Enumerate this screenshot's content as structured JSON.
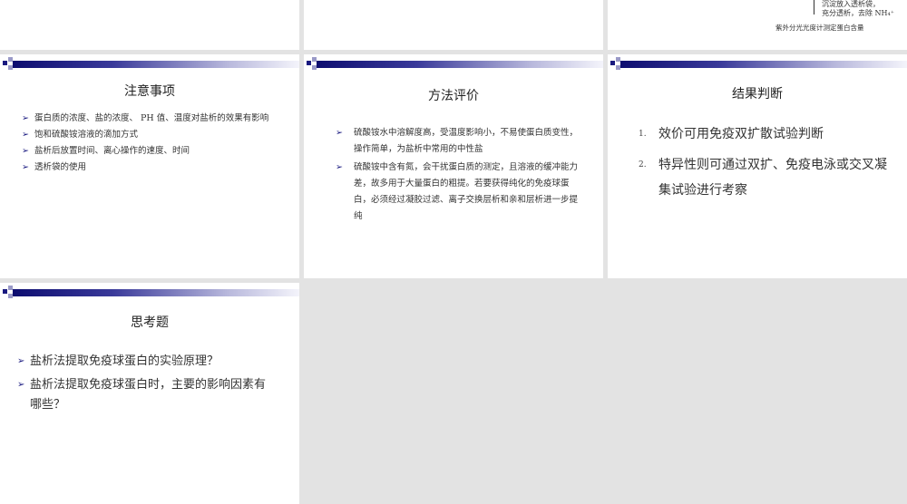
{
  "slides": [
    {
      "partial_lines": [
        "沉淀放入透析袋，",
        "充分透析，去除 NH₄⁺"
      ],
      "caption": "紫外分光光度计测定蛋白含量"
    },
    {
      "title": "注意事项",
      "bullets": [
        "蛋白质的浓度、盐的浓度、 PH 值、温度对盐析的效果有影响",
        "饱和硫酸铵溶液的滴加方式",
        "盐析后放置时间、离心操作的速度、时间",
        "透析袋的使用"
      ]
    },
    {
      "title": "方法评价",
      "bullets": [
        "硫酸铵水中溶解度高，受温度影响小，不易使蛋白质变性，操作简单，为盐析中常用的中性盐",
        "硫酸铵中含有氮，会干扰蛋白质的测定，且溶液的缓冲能力差，故多用于大量蛋白的粗提。若要获得纯化的免疫球蛋白，必须经过凝胶过滤、离子交换层析和亲和层析进一步提纯"
      ]
    },
    {
      "title": "结果判断",
      "items": [
        {
          "num": "1.",
          "text": "效价可用免疫双扩散试验判断"
        },
        {
          "num": "2.",
          "text": "特异性则可通过双扩、免疫电泳或交叉凝集试验进行考察"
        }
      ]
    },
    {
      "title": "思考题",
      "bullets": [
        "盐析法提取免疫球蛋白的实验原理？",
        "盐析法提取免疫球蛋白时，主要的影响因素有哪些？"
      ]
    }
  ],
  "bullet_glyph": "➢"
}
